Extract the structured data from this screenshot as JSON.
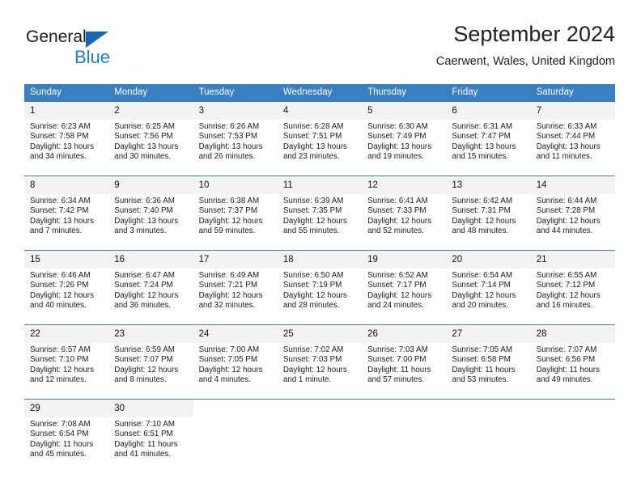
{
  "brand": {
    "name_part1": "General",
    "name_part2": "Blue",
    "triangle_color": "#1268b3",
    "blue_color": "#1b7fd4"
  },
  "header": {
    "title": "September 2024",
    "subtitle": "Caerwent, Wales, United Kingdom"
  },
  "colors": {
    "header_bg": "#3a7fc1",
    "daynum_bg": "#f2f2f2",
    "row_divider": "#4a7fb5"
  },
  "weekdays": [
    "Sunday",
    "Monday",
    "Tuesday",
    "Wednesday",
    "Thursday",
    "Friday",
    "Saturday"
  ],
  "weeks": [
    [
      {
        "day": "1",
        "sunrise": "Sunrise: 6:23 AM",
        "sunset": "Sunset: 7:58 PM",
        "daylight1": "Daylight: 13 hours",
        "daylight2": "and 34 minutes."
      },
      {
        "day": "2",
        "sunrise": "Sunrise: 6:25 AM",
        "sunset": "Sunset: 7:56 PM",
        "daylight1": "Daylight: 13 hours",
        "daylight2": "and 30 minutes."
      },
      {
        "day": "3",
        "sunrise": "Sunrise: 6:26 AM",
        "sunset": "Sunset: 7:53 PM",
        "daylight1": "Daylight: 13 hours",
        "daylight2": "and 26 minutes."
      },
      {
        "day": "4",
        "sunrise": "Sunrise: 6:28 AM",
        "sunset": "Sunset: 7:51 PM",
        "daylight1": "Daylight: 13 hours",
        "daylight2": "and 23 minutes."
      },
      {
        "day": "5",
        "sunrise": "Sunrise: 6:30 AM",
        "sunset": "Sunset: 7:49 PM",
        "daylight1": "Daylight: 13 hours",
        "daylight2": "and 19 minutes."
      },
      {
        "day": "6",
        "sunrise": "Sunrise: 6:31 AM",
        "sunset": "Sunset: 7:47 PM",
        "daylight1": "Daylight: 13 hours",
        "daylight2": "and 15 minutes."
      },
      {
        "day": "7",
        "sunrise": "Sunrise: 6:33 AM",
        "sunset": "Sunset: 7:44 PM",
        "daylight1": "Daylight: 13 hours",
        "daylight2": "and 11 minutes."
      }
    ],
    [
      {
        "day": "8",
        "sunrise": "Sunrise: 6:34 AM",
        "sunset": "Sunset: 7:42 PM",
        "daylight1": "Daylight: 13 hours",
        "daylight2": "and 7 minutes."
      },
      {
        "day": "9",
        "sunrise": "Sunrise: 6:36 AM",
        "sunset": "Sunset: 7:40 PM",
        "daylight1": "Daylight: 13 hours",
        "daylight2": "and 3 minutes."
      },
      {
        "day": "10",
        "sunrise": "Sunrise: 6:38 AM",
        "sunset": "Sunset: 7:37 PM",
        "daylight1": "Daylight: 12 hours",
        "daylight2": "and 59 minutes."
      },
      {
        "day": "11",
        "sunrise": "Sunrise: 6:39 AM",
        "sunset": "Sunset: 7:35 PM",
        "daylight1": "Daylight: 12 hours",
        "daylight2": "and 55 minutes."
      },
      {
        "day": "12",
        "sunrise": "Sunrise: 6:41 AM",
        "sunset": "Sunset: 7:33 PM",
        "daylight1": "Daylight: 12 hours",
        "daylight2": "and 52 minutes."
      },
      {
        "day": "13",
        "sunrise": "Sunrise: 6:42 AM",
        "sunset": "Sunset: 7:31 PM",
        "daylight1": "Daylight: 12 hours",
        "daylight2": "and 48 minutes."
      },
      {
        "day": "14",
        "sunrise": "Sunrise: 6:44 AM",
        "sunset": "Sunset: 7:28 PM",
        "daylight1": "Daylight: 12 hours",
        "daylight2": "and 44 minutes."
      }
    ],
    [
      {
        "day": "15",
        "sunrise": "Sunrise: 6:46 AM",
        "sunset": "Sunset: 7:26 PM",
        "daylight1": "Daylight: 12 hours",
        "daylight2": "and 40 minutes."
      },
      {
        "day": "16",
        "sunrise": "Sunrise: 6:47 AM",
        "sunset": "Sunset: 7:24 PM",
        "daylight1": "Daylight: 12 hours",
        "daylight2": "and 36 minutes."
      },
      {
        "day": "17",
        "sunrise": "Sunrise: 6:49 AM",
        "sunset": "Sunset: 7:21 PM",
        "daylight1": "Daylight: 12 hours",
        "daylight2": "and 32 minutes."
      },
      {
        "day": "18",
        "sunrise": "Sunrise: 6:50 AM",
        "sunset": "Sunset: 7:19 PM",
        "daylight1": "Daylight: 12 hours",
        "daylight2": "and 28 minutes."
      },
      {
        "day": "19",
        "sunrise": "Sunrise: 6:52 AM",
        "sunset": "Sunset: 7:17 PM",
        "daylight1": "Daylight: 12 hours",
        "daylight2": "and 24 minutes."
      },
      {
        "day": "20",
        "sunrise": "Sunrise: 6:54 AM",
        "sunset": "Sunset: 7:14 PM",
        "daylight1": "Daylight: 12 hours",
        "daylight2": "and 20 minutes."
      },
      {
        "day": "21",
        "sunrise": "Sunrise: 6:55 AM",
        "sunset": "Sunset: 7:12 PM",
        "daylight1": "Daylight: 12 hours",
        "daylight2": "and 16 minutes."
      }
    ],
    [
      {
        "day": "22",
        "sunrise": "Sunrise: 6:57 AM",
        "sunset": "Sunset: 7:10 PM",
        "daylight1": "Daylight: 12 hours",
        "daylight2": "and 12 minutes."
      },
      {
        "day": "23",
        "sunrise": "Sunrise: 6:59 AM",
        "sunset": "Sunset: 7:07 PM",
        "daylight1": "Daylight: 12 hours",
        "daylight2": "and 8 minutes."
      },
      {
        "day": "24",
        "sunrise": "Sunrise: 7:00 AM",
        "sunset": "Sunset: 7:05 PM",
        "daylight1": "Daylight: 12 hours",
        "daylight2": "and 4 minutes."
      },
      {
        "day": "25",
        "sunrise": "Sunrise: 7:02 AM",
        "sunset": "Sunset: 7:03 PM",
        "daylight1": "Daylight: 12 hours",
        "daylight2": "and 1 minute."
      },
      {
        "day": "26",
        "sunrise": "Sunrise: 7:03 AM",
        "sunset": "Sunset: 7:00 PM",
        "daylight1": "Daylight: 11 hours",
        "daylight2": "and 57 minutes."
      },
      {
        "day": "27",
        "sunrise": "Sunrise: 7:05 AM",
        "sunset": "Sunset: 6:58 PM",
        "daylight1": "Daylight: 11 hours",
        "daylight2": "and 53 minutes."
      },
      {
        "day": "28",
        "sunrise": "Sunrise: 7:07 AM",
        "sunset": "Sunset: 6:56 PM",
        "daylight1": "Daylight: 11 hours",
        "daylight2": "and 49 minutes."
      }
    ],
    [
      {
        "day": "29",
        "sunrise": "Sunrise: 7:08 AM",
        "sunset": "Sunset: 6:54 PM",
        "daylight1": "Daylight: 11 hours",
        "daylight2": "and 45 minutes."
      },
      {
        "day": "30",
        "sunrise": "Sunrise: 7:10 AM",
        "sunset": "Sunset: 6:51 PM",
        "daylight1": "Daylight: 11 hours",
        "daylight2": "and 41 minutes."
      },
      {
        "day": "",
        "sunrise": "",
        "sunset": "",
        "daylight1": "",
        "daylight2": ""
      },
      {
        "day": "",
        "sunrise": "",
        "sunset": "",
        "daylight1": "",
        "daylight2": ""
      },
      {
        "day": "",
        "sunrise": "",
        "sunset": "",
        "daylight1": "",
        "daylight2": ""
      },
      {
        "day": "",
        "sunrise": "",
        "sunset": "",
        "daylight1": "",
        "daylight2": ""
      },
      {
        "day": "",
        "sunrise": "",
        "sunset": "",
        "daylight1": "",
        "daylight2": ""
      }
    ]
  ]
}
